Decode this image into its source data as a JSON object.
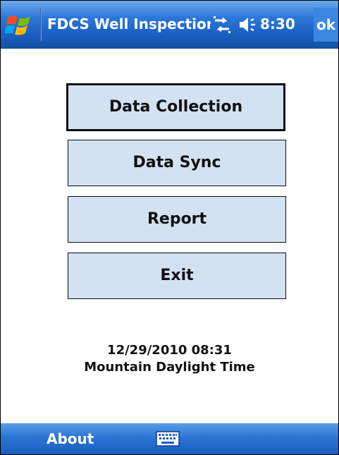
{
  "window": {
    "title": "FDCS Well Inspection",
    "clock": "8:30",
    "ok_label": "ok"
  },
  "icons": {
    "start": "windows-flag-icon",
    "connectivity": "connectivity-arrows-icon",
    "volume": "speaker-icon",
    "keyboard": "keyboard-icon"
  },
  "menu": {
    "data_collection": "Data Collection",
    "data_sync": "Data Sync",
    "report": "Report",
    "exit": "Exit"
  },
  "status": {
    "datetime": "12/29/2010 08:31",
    "timezone": "Mountain Daylight Time"
  },
  "softkeys": {
    "left": "About"
  },
  "colors": {
    "titlebar": "#2d78d8",
    "button_fill": "#d3e2f1",
    "button_border": "#0b0b0b"
  }
}
